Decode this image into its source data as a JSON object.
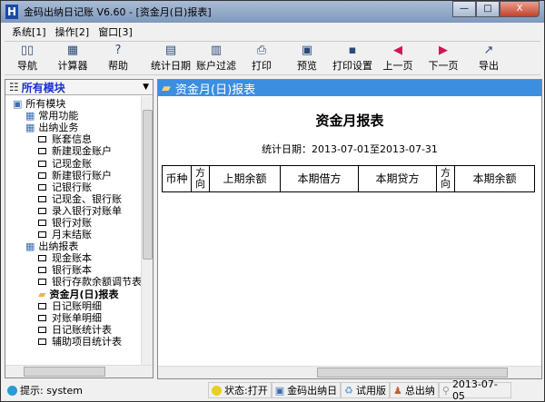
{
  "window": {
    "title": "金码出纳日记账 V6.60 - [资金月(日)报表]",
    "min": "—",
    "max": "□",
    "close": "X"
  },
  "menu": [
    "系统[1]",
    "操作[2]",
    "窗口[3]"
  ],
  "toolbar": [
    {
      "label": "导航",
      "icon": "book-icon",
      "glyph": "▯▯"
    },
    {
      "label": "计算器",
      "icon": "calculator-icon",
      "glyph": "▦"
    },
    {
      "label": "帮助",
      "icon": "help-icon",
      "glyph": "?"
    },
    {
      "label": "统计日期",
      "icon": "calendar-icon",
      "glyph": "▤"
    },
    {
      "label": "账户过滤",
      "icon": "filter-icon",
      "glyph": "▥"
    },
    {
      "label": "打印",
      "icon": "printer-icon",
      "glyph": "⎙"
    },
    {
      "label": "预览",
      "icon": "preview-icon",
      "glyph": "▣"
    },
    {
      "label": "打印设置",
      "icon": "print-settings-icon",
      "glyph": "▪"
    },
    {
      "label": "上一页",
      "icon": "arrow-left-icon",
      "glyph": "◀"
    },
    {
      "label": "下一页",
      "icon": "arrow-right-icon",
      "glyph": "▶"
    },
    {
      "label": "导出",
      "icon": "export-icon",
      "glyph": "↗"
    }
  ],
  "left": {
    "header": "所有模块",
    "tree": [
      {
        "label": "所有模块",
        "level": 0,
        "kind": "root"
      },
      {
        "label": "常用功能",
        "level": 1,
        "kind": "group"
      },
      {
        "label": "出纳业务",
        "level": 1,
        "kind": "group"
      },
      {
        "label": "账套信息",
        "level": 2
      },
      {
        "label": "新建现金账户",
        "level": 2
      },
      {
        "label": "记现金账",
        "level": 2
      },
      {
        "label": "新建银行账户",
        "level": 2
      },
      {
        "label": "记银行账",
        "level": 2
      },
      {
        "label": "记现金、银行账",
        "level": 2
      },
      {
        "label": "录入银行对账单",
        "level": 2
      },
      {
        "label": "银行对账",
        "level": 2
      },
      {
        "label": "月末结账",
        "level": 2
      },
      {
        "label": "出纳报表",
        "level": 1,
        "kind": "group"
      },
      {
        "label": "现金账本",
        "level": 2
      },
      {
        "label": "银行账本",
        "level": 2
      },
      {
        "label": "银行存款余额调节表",
        "level": 2
      },
      {
        "label": "资金月(日)报表",
        "level": 2,
        "kind": "selected"
      },
      {
        "label": "日记账明细",
        "level": 2
      },
      {
        "label": "对账单明细",
        "level": 2
      },
      {
        "label": "日记账统计表",
        "level": 2
      },
      {
        "label": "辅助项目统计表",
        "level": 2
      }
    ]
  },
  "report": {
    "header": "资金月(日)报表",
    "title": "资金月报表",
    "date": "统计日期：2013-07-01至2013-07-31",
    "columns": [
      "币种",
      "方向",
      "上期余额",
      "本期借方",
      "本期贷方",
      "方向",
      "本期余额"
    ]
  },
  "status": {
    "hint": "提示: system",
    "state": "状态:打开",
    "app": "金码出纳日",
    "version": "试用版",
    "user": "总出纳",
    "date": "2013-07-05"
  }
}
